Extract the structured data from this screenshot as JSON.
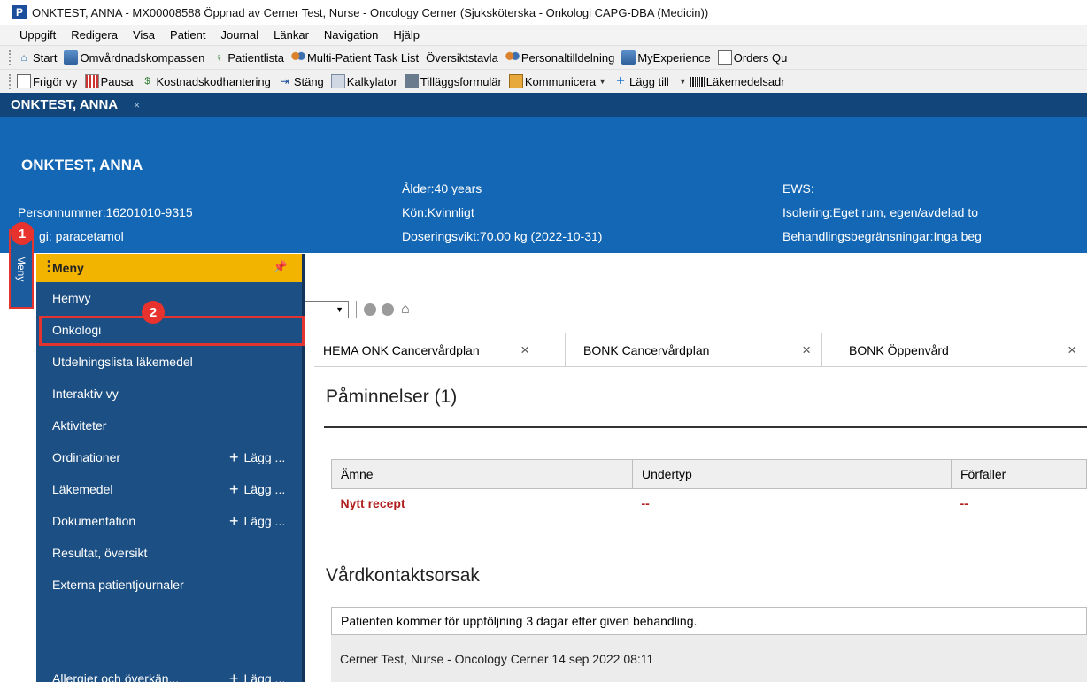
{
  "window": {
    "app_letter": "P",
    "title": "ONKTEST, ANNA - MX00008588 Öppnad av Cerner Test, Nurse - Oncology Cerner (Sjuksköterska - Onkologi CAPG-DBA (Medicin))"
  },
  "menubar": [
    "Uppgift",
    "Redigera",
    "Visa",
    "Patient",
    "Journal",
    "Länkar",
    "Navigation",
    "Hjälp"
  ],
  "toolbar1": [
    {
      "label": "Start",
      "icon": "home-icon"
    },
    {
      "label": "Omvårdnadskompassen",
      "icon": "book-icon"
    },
    {
      "label": "Patientlista",
      "icon": "person-icon"
    },
    {
      "label": "Multi-Patient Task List",
      "icon": "multi-patient-icon"
    },
    {
      "label": "Översiktstavla",
      "icon": ""
    },
    {
      "label": "Personaltilldelning",
      "icon": "staff-icon"
    },
    {
      "label": "MyExperience",
      "icon": "book-icon"
    },
    {
      "label": "Orders Qu",
      "icon": "document-icon"
    }
  ],
  "toolbar2": [
    {
      "label": "Frigör vy",
      "icon": "detach-icon"
    },
    {
      "label": "Pausa",
      "icon": "pause-grid-icon"
    },
    {
      "label": "Kostnadskodhantering",
      "icon": "money-icon"
    },
    {
      "label": "Stäng",
      "icon": "exit-icon"
    },
    {
      "label": "Kalkylator",
      "icon": "calculator-icon"
    },
    {
      "label": "Tilläggsformulär",
      "icon": "form-icon"
    },
    {
      "label": "Kommunicera",
      "icon": "mail-icon"
    },
    {
      "label": "Lägg till",
      "icon": "plus-icon"
    },
    {
      "label": "Läkemedelsadr",
      "icon": "barcode-icon"
    }
  ],
  "patient_tab": {
    "label": "ONKTEST, ANNA",
    "close": "×"
  },
  "banner": {
    "name": "ONKTEST, ANNA",
    "personnummer": "Personnummer:16201010-9315",
    "allergy": "gi: paracetamol",
    "age": "Ålder:40 years",
    "sex": "Kön:Kvinnligt",
    "weight": "Doseringsvikt:70.00 kg (2022-10-31)",
    "ews": "EWS:",
    "isolation": "Isolering:Eget rum, egen/avdelad to",
    "limits": "Behandlingsbegränsningar:Inga beg"
  },
  "side_tab_label": "Meny",
  "badges": {
    "one": "1",
    "two": "2"
  },
  "menu": {
    "header": "Meny",
    "items": [
      {
        "label": "Hemvy",
        "add": ""
      },
      {
        "label": "Onkologi",
        "add": ""
      },
      {
        "label": "Utdelningslista läkemedel",
        "add": ""
      },
      {
        "label": "Interaktiv vy",
        "add": ""
      },
      {
        "label": "Aktiviteter",
        "add": ""
      },
      {
        "label": "Ordinationer",
        "add": "Lägg ..."
      },
      {
        "label": "Läkemedel",
        "add": "Lägg ..."
      },
      {
        "label": "Dokumentation",
        "add": "Lägg ..."
      },
      {
        "label": "Resultat, översikt",
        "add": ""
      },
      {
        "label": "Externa patientjournaler",
        "add": ""
      },
      {
        "label": "Allergier och överkän...",
        "add": "Lägg ..."
      }
    ]
  },
  "content": {
    "tabs": [
      {
        "label": "HEMA ONK Cancervårdplan",
        "close": "×"
      },
      {
        "label": "BONK Cancervårdplan",
        "close": "×"
      },
      {
        "label": "BONK Öppenvård",
        "close": "×"
      }
    ],
    "reminders_title": "Påminnelser",
    "reminders_count": "(1)",
    "table": {
      "headers": [
        "Ämne",
        "Undertyp",
        "Förfaller"
      ],
      "rows": [
        [
          "Nytt recept",
          "--",
          "--"
        ]
      ]
    },
    "reason_title": "Vårdkontaktsorsak",
    "reason_text": "Patienten kommer för uppföljning 3 dagar efter given behandling.",
    "reason_author": "Cerner Test, Nurse - Oncology Cerner 14 sep 2022 08:11"
  },
  "colors": {
    "banner": "#1467b4",
    "menu_header": "#f3b400",
    "highlight": "#e3342f"
  }
}
